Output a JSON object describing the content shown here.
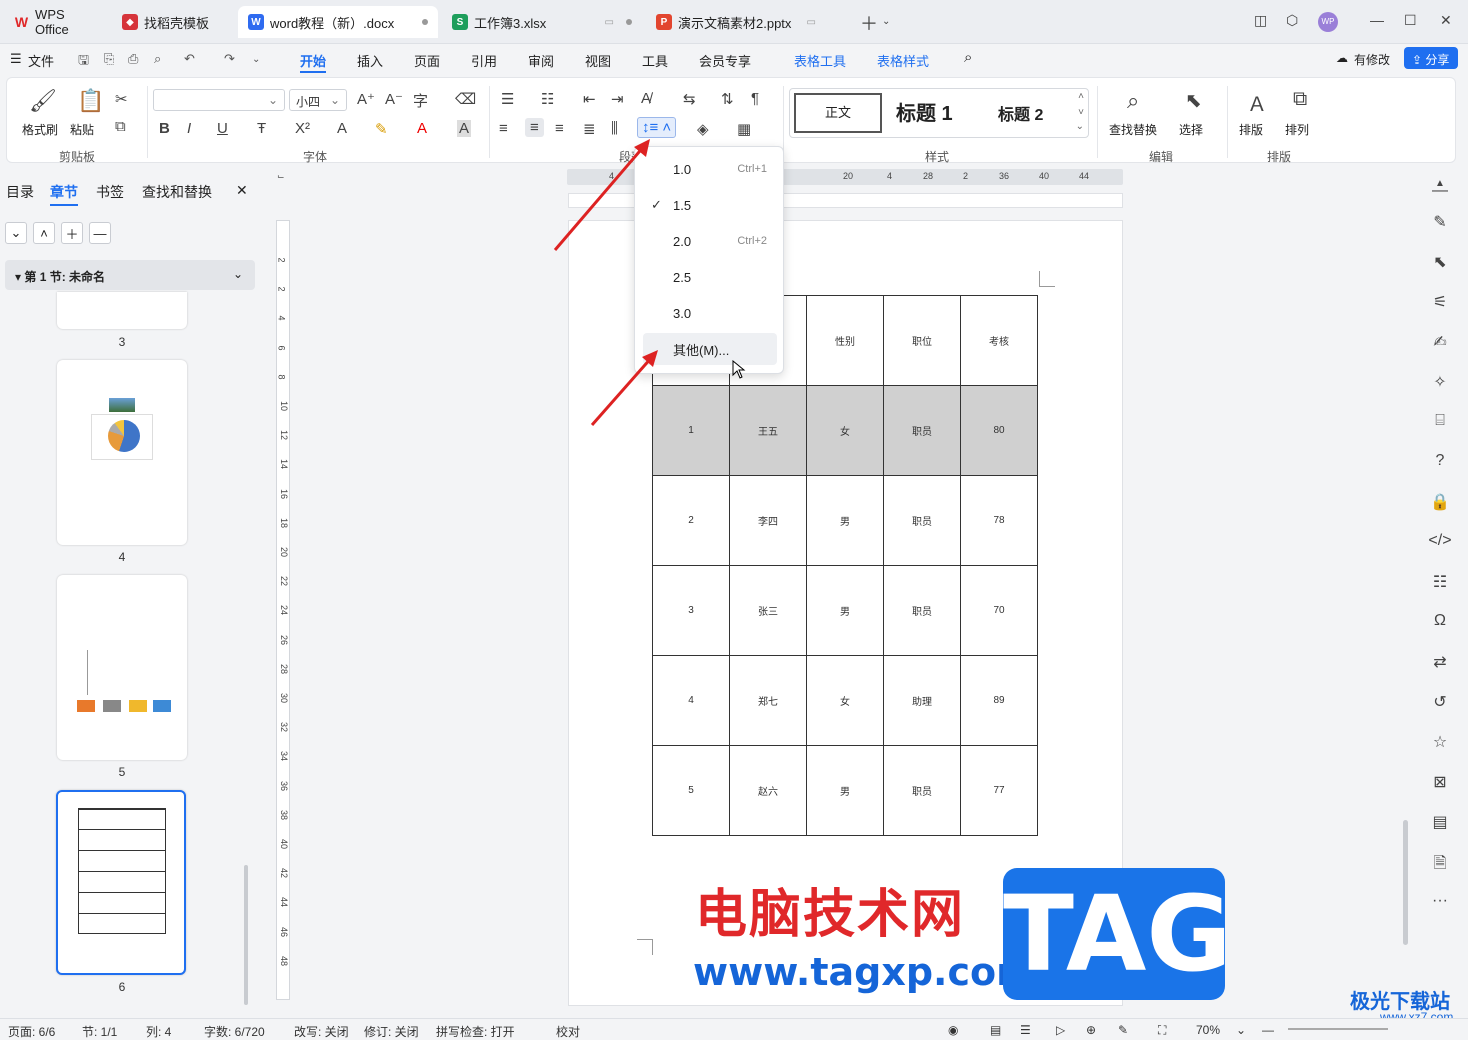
{
  "tabs": [
    {
      "label": "WPS Office",
      "icon": "wps-logo-icon",
      "color": "#e0282a"
    },
    {
      "label": "找稻壳模板",
      "icon": "docer-icon",
      "color": "#d6343b"
    },
    {
      "label": "word教程（新）.docx",
      "icon": "word-icon",
      "color": "#2f6bf0"
    },
    {
      "label": "工作簿3.xlsx",
      "icon": "excel-icon",
      "color": "#1e9e5c"
    },
    {
      "label": "演示文稿素材2.pptx",
      "icon": "ppt-icon",
      "color": "#e2452f"
    }
  ],
  "tab_icon_letters": {
    "word": "W",
    "excel": "S",
    "ppt": "P"
  },
  "avatar": "WP",
  "menu": {
    "file": "文件",
    "items": [
      "开始",
      "插入",
      "页面",
      "引用",
      "审阅",
      "视图",
      "工具",
      "会员专享"
    ],
    "table_tools": "表格工具",
    "table_style": "表格样式",
    "modified": "有修改",
    "share": "分享"
  },
  "ribbon": {
    "format_painter": "格式刷",
    "paste": "粘贴",
    "group_clipboard": "剪贴板",
    "font_size": "小四",
    "group_font": "字体",
    "group_paragraph": "段落",
    "styles": [
      "正文",
      "标题 1",
      "标题 2"
    ],
    "group_styles": "样式",
    "find_replace": "查找替换",
    "select": "选择",
    "group_edit": "编辑",
    "layout": "排版",
    "arrange": "排列",
    "group_layout": "排版"
  },
  "nav": {
    "tabs": [
      "目录",
      "章节",
      "书签",
      "查找和替换"
    ],
    "section": "第 1 节: 未命名",
    "thumbs": [
      "3",
      "4",
      "5",
      "6"
    ]
  },
  "ruler_h": [
    "4",
    "20",
    "4",
    "28",
    "2",
    "36",
    "40",
    "44"
  ],
  "ruler_v": [
    "2",
    "2",
    "4",
    "6",
    "8",
    "10",
    "12",
    "14",
    "16",
    "18",
    "20",
    "22",
    "24",
    "26",
    "28",
    "30",
    "32",
    "34",
    "36",
    "38",
    "40",
    "42",
    "44",
    "46",
    "48"
  ],
  "table": {
    "header": [
      "",
      "",
      "性别",
      "职位",
      "考核"
    ],
    "rows": [
      [
        "1",
        "王五",
        "女",
        "职员",
        "80"
      ],
      [
        "2",
        "李四",
        "男",
        "职员",
        "78"
      ],
      [
        "3",
        "张三",
        "男",
        "职员",
        "70"
      ],
      [
        "4",
        "郑七",
        "女",
        "助理",
        "89"
      ],
      [
        "5",
        "赵六",
        "男",
        "职员",
        "77"
      ]
    ]
  },
  "line_spacing_menu": {
    "items": [
      {
        "label": "1.0",
        "shortcut": "Ctrl+1",
        "checked": false
      },
      {
        "label": "1.5",
        "shortcut": "",
        "checked": true
      },
      {
        "label": "2.0",
        "shortcut": "Ctrl+2",
        "checked": false
      },
      {
        "label": "2.5",
        "shortcut": "",
        "checked": false
      },
      {
        "label": "3.0",
        "shortcut": "",
        "checked": false
      },
      {
        "label": "其他(M)...",
        "shortcut": "",
        "checked": false
      }
    ]
  },
  "status": {
    "page": "页面: 6/6",
    "section": "节: 1/1",
    "column": "列: 4",
    "words": "字数: 6/720",
    "overwrite": "改写: 关闭",
    "revise": "修订: 关闭",
    "spell": "拼写检查: 打开",
    "proof": "校对",
    "zoom": "70%"
  },
  "watermark": {
    "cn": "电脑技术网",
    "url": "www.tagxp.com",
    "tag": "TAG",
    "site": "极光下载站",
    "site_url": "www.xz7.com"
  }
}
